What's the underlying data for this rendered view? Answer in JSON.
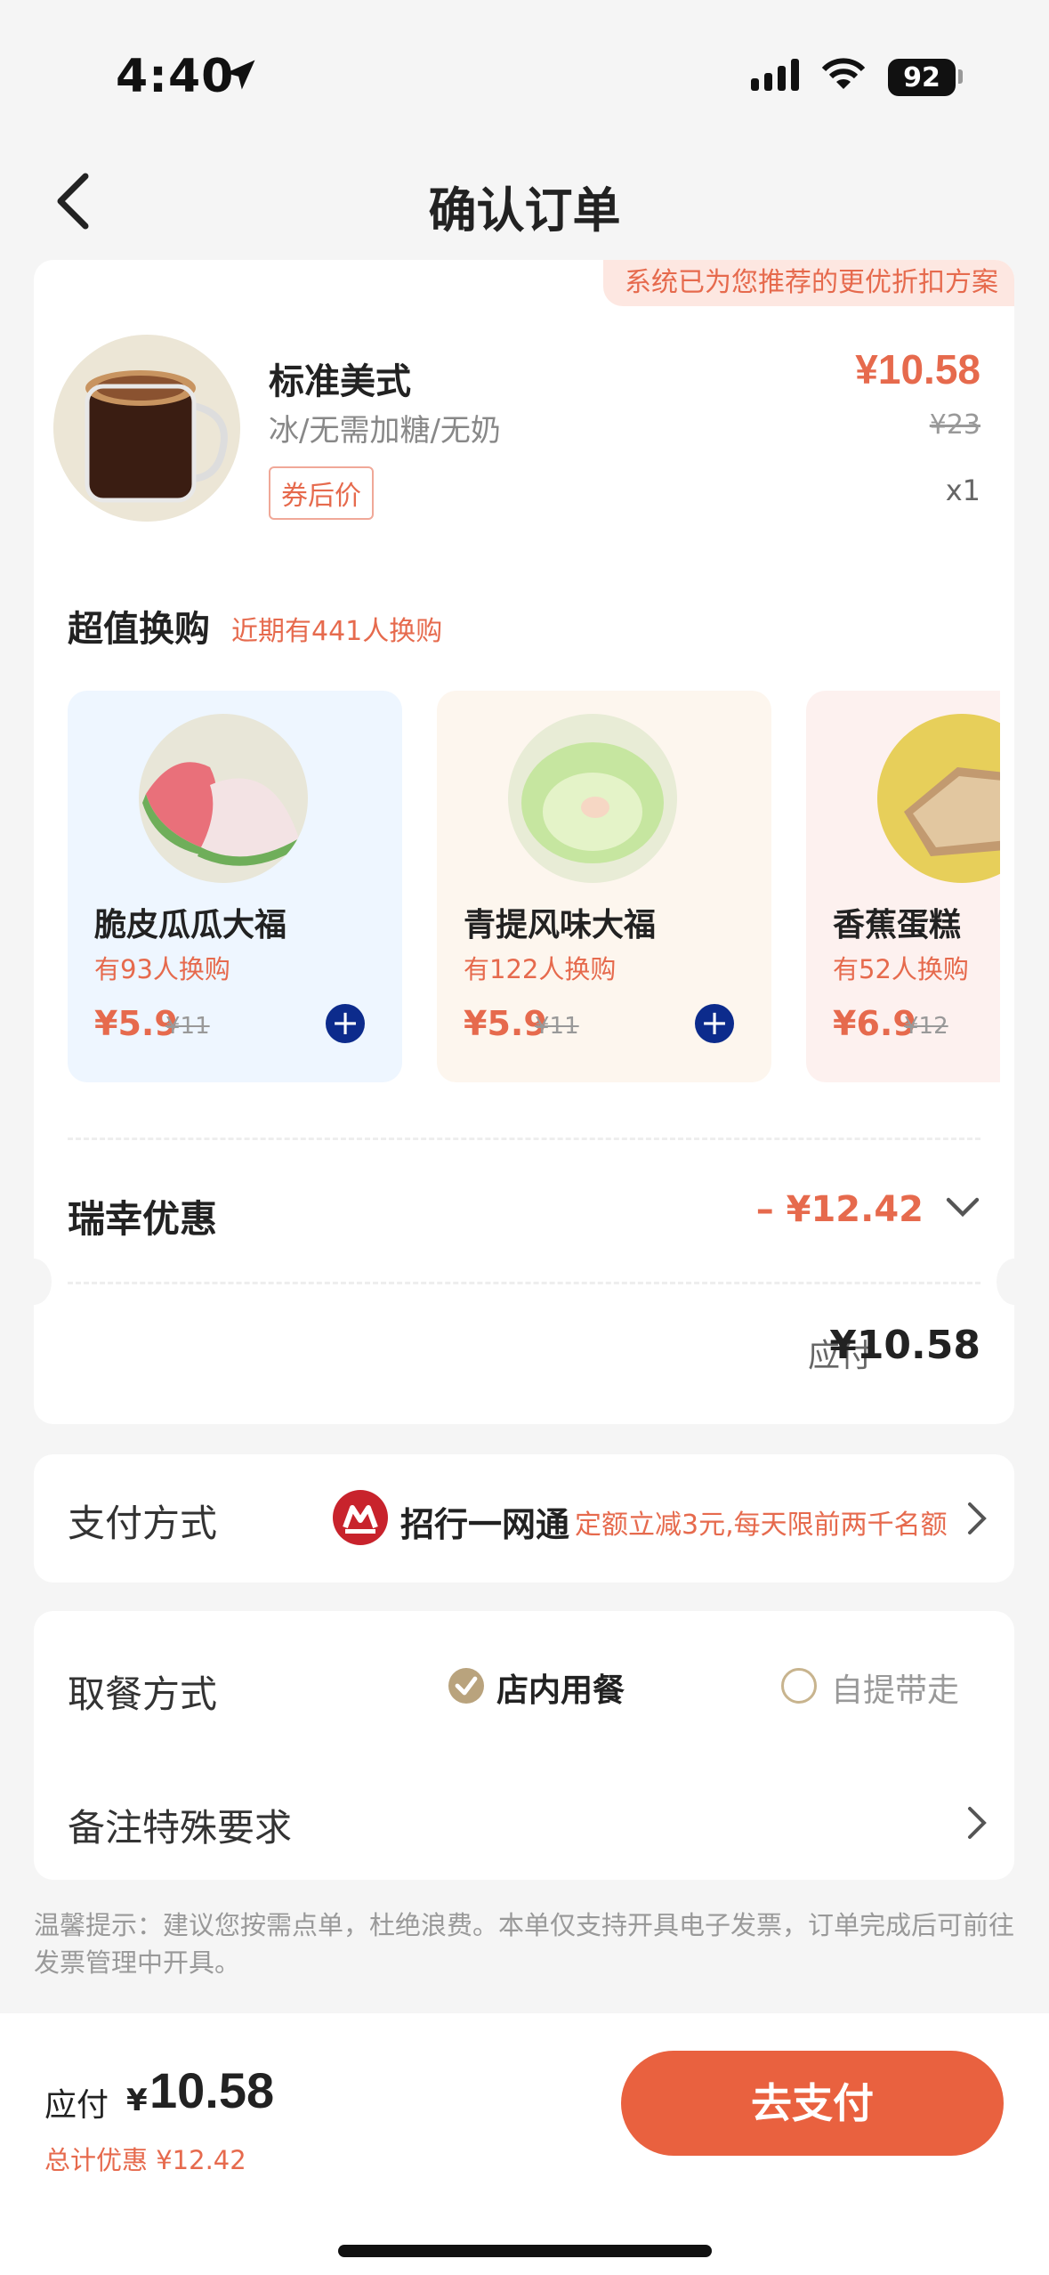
{
  "status": {
    "time": "4:40",
    "battery": "92"
  },
  "nav": {
    "title": "确认订单"
  },
  "order": {
    "recommend_banner": "系统已为您推荐的更优折扣方案",
    "product": {
      "name": "标准美式",
      "spec": "冰/无需加糖/无奶",
      "tag": "券后价",
      "price": "¥10.58",
      "original_price": "¥23",
      "quantity": "x1"
    },
    "upsell": {
      "title": "超值换购",
      "subtitle": "近期有441人换购",
      "items": [
        {
          "name": "脆皮瓜瓜大福",
          "count": "有93人换购",
          "price": "¥5.9",
          "original": "¥11",
          "bg": "#eef6ff",
          "thumb_bg": "#e8e6d8"
        },
        {
          "name": "青提风味大福",
          "count": "有122人换购",
          "price": "¥5.9",
          "original": "¥11",
          "bg": "#fdf6ee",
          "thumb_bg": "#e8ecd6"
        },
        {
          "name": "香蕉蛋糕",
          "count": "有52人换购",
          "price": "¥6.9",
          "original": "¥12",
          "bg": "#fdf1ef",
          "thumb_bg": "#e7cf5a"
        }
      ]
    },
    "discount": {
      "label": "瑞幸优惠",
      "value": "– ¥12.42"
    },
    "due": {
      "label": "应付",
      "value": "¥10.58"
    }
  },
  "payment": {
    "label": "支付方式",
    "method": "招行一网通",
    "promo": "定额立减3元,每天限前两千名额"
  },
  "pickup": {
    "label": "取餐方式",
    "options": [
      "店内用餐",
      "自提带走"
    ],
    "selected": "店内用餐",
    "remark_label": "备注特殊要求"
  },
  "tip": "温馨提示：建议您按需点单，杜绝浪费。本单仅支持开具电子发票，订单完成后可前往发票管理中开具。",
  "bottom": {
    "label": "应付",
    "currency": "¥",
    "total": "10.58",
    "saved": "总计优惠 ¥12.42",
    "pay_button": "去支付"
  },
  "colors": {
    "accent": "#e9613f",
    "price": "#e66a4d",
    "add_button": "#0c2b8c",
    "radio": "#b9a37d"
  }
}
